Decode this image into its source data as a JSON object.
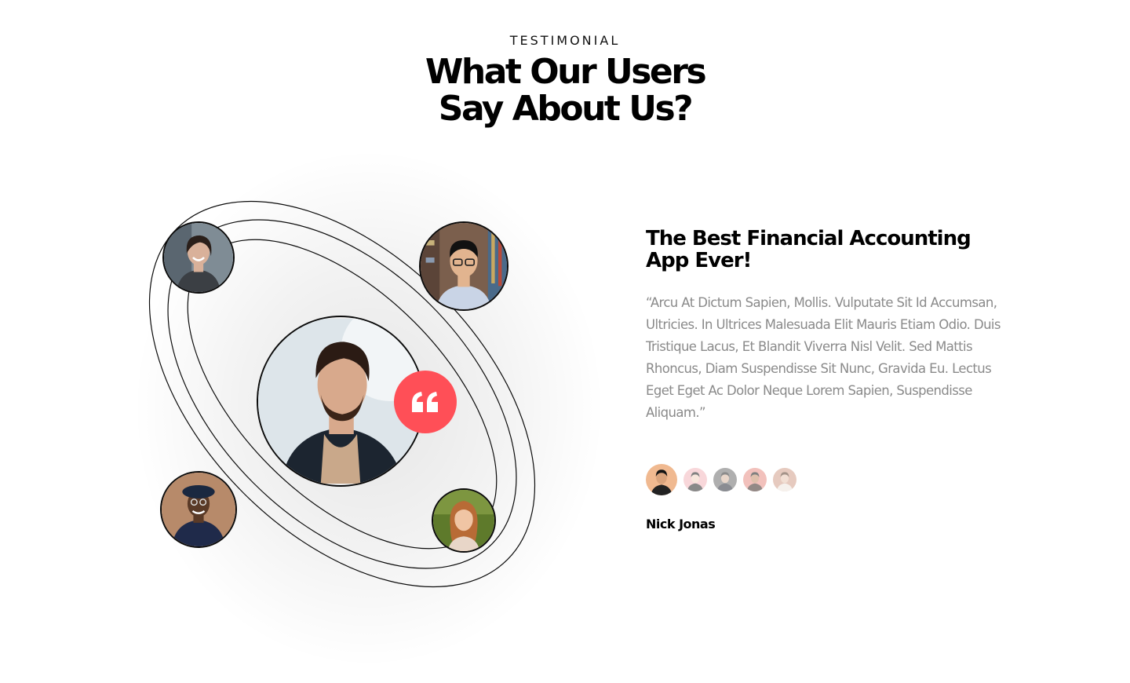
{
  "section": {
    "eyebrow": "TESTIMONIAL",
    "headline_line1": "What Our Users",
    "headline_line2": "Say About Us?"
  },
  "orbit": {
    "avatars": [
      {
        "name": "woman-laughing",
        "skin": "#d9b19a",
        "hair": "#2a1f1a",
        "bg": "#7f8c95",
        "shirt": "#3b3f44"
      },
      {
        "name": "man-glasses",
        "skin": "#e2b48f",
        "hair": "#111111",
        "bg": "#7b5f4d",
        "shirt": "#c9d4e6"
      },
      {
        "name": "man-beret",
        "skin": "#5a3a27",
        "hair": "#1a2840",
        "bg": "#b78a6a",
        "shirt": "#1f2a4a"
      },
      {
        "name": "woman-redhead",
        "skin": "#f0c5a4",
        "hair": "#b86b36",
        "bg": "#5e7a2b",
        "shirt": "#e8d6c8"
      }
    ],
    "featured": {
      "name": "man-beard-featured",
      "skin": "#d8a98c",
      "hair": "#2b1b14",
      "bg": "#dde5ea",
      "shirt": "#1c2530"
    }
  },
  "quote_icon": "quote-icon",
  "colors": {
    "accent": "#ff4f57",
    "body_text": "#8a8a8a",
    "ring_stroke": "#0b0b0b"
  },
  "testimonial": {
    "title": "The Best Financial Accounting App Ever!",
    "body": "“Arcu At Dictum Sapien, Mollis. Vulputate Sit Id Accumsan, Ultricies. In Ultrices Malesuada Elit Mauris Etiam Odio. Duis Tristique Lacus, Et Blandit Viverra Nisl Velit. Sed Mattis Rhoncus, Diam Suspendisse Sit Nunc, Gravida Eu. Lectus Eget Eget Ac Dolor Neque Lorem Sapien, Suspendisse Aliquam.”",
    "author": "Nick Jonas",
    "thumbnails": [
      {
        "name": "user-thumb-1",
        "bg": "#f0b990",
        "skin": "#d9a37c",
        "hair": "#141414",
        "shirt": "#222222",
        "active": true
      },
      {
        "name": "user-thumb-2",
        "bg": "#f3b7bd",
        "skin": "#f2d2c0",
        "hair": "#1b1b1b",
        "shirt": "#2a2a2a",
        "active": false
      },
      {
        "name": "user-thumb-3",
        "bg": "#6f6f6f",
        "skin": "#d6b6a0",
        "hair": "#2d2d2d",
        "shirt": "#2b2f3a",
        "active": false
      },
      {
        "name": "user-thumb-4",
        "bg": "#e98f86",
        "skin": "#c58e6a",
        "hair": "#1a1a1a",
        "shirt": "#3b2a24",
        "active": false
      },
      {
        "name": "user-thumb-5",
        "bg": "#d2a08c",
        "skin": "#e8c6b2",
        "hair": "#5a3b2a",
        "shirt": "#efe6df",
        "active": false
      }
    ]
  }
}
